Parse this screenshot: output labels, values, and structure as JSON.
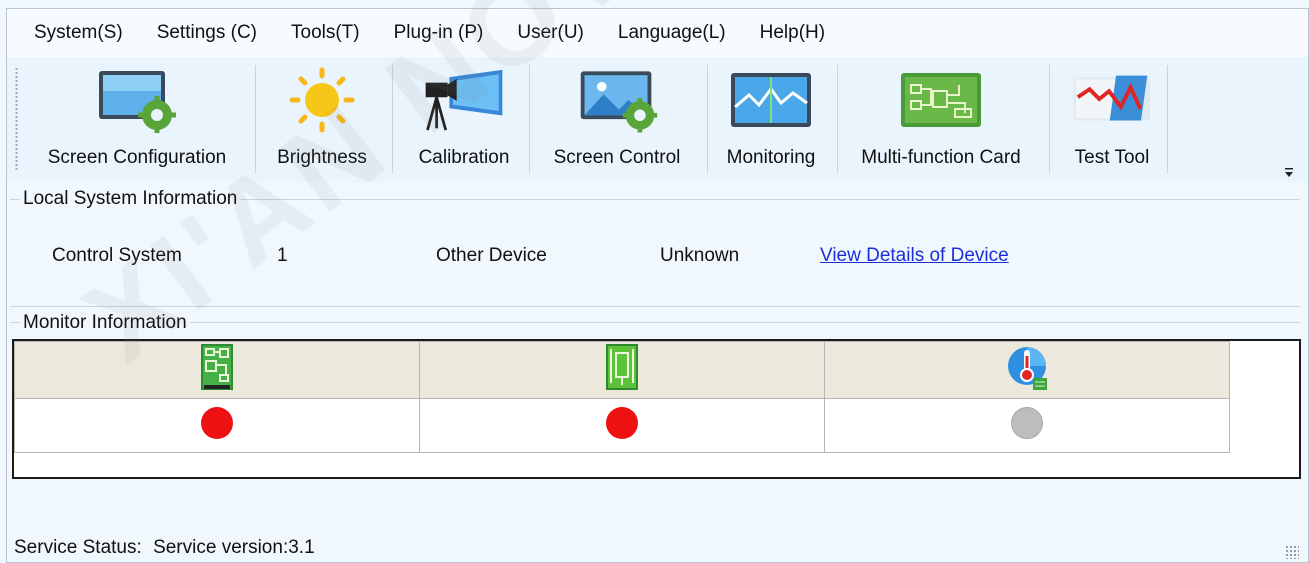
{
  "menu": {
    "items": [
      "System(S)",
      "Settings (C)",
      "Tools(T)",
      "Plug-in (P)",
      "User(U)",
      "Language(L)",
      "Help(H)"
    ]
  },
  "toolbar": {
    "tools": [
      {
        "label": "Screen Configuration",
        "icon": "screen-configuration-icon"
      },
      {
        "label": "Brightness",
        "icon": "brightness-sun-icon"
      },
      {
        "label": "Calibration",
        "icon": "calibration-camera-icon"
      },
      {
        "label": "Screen Control",
        "icon": "screen-control-icon"
      },
      {
        "label": "Monitoring",
        "icon": "monitoring-icon"
      },
      {
        "label": "Multi-function Card",
        "icon": "multi-function-card-icon"
      },
      {
        "label": "Test Tool",
        "icon": "test-tool-icon"
      }
    ]
  },
  "local_system": {
    "title": "Local System Information",
    "control_system_label": "Control System",
    "control_system_value": "1",
    "other_device_label": "Other Device",
    "other_device_value": "Unknown",
    "details_link": "View Details of Device"
  },
  "monitor": {
    "title": "Monitor Information",
    "columns": [
      {
        "icon": "sending-card-icon",
        "status": "error",
        "status_color": "#ee1111"
      },
      {
        "icon": "receiving-card-icon",
        "status": "error",
        "status_color": "#ee1111"
      },
      {
        "icon": "temperature-icon",
        "status": "unknown",
        "status_color": "#bdbdbd"
      }
    ]
  },
  "status_bar": {
    "label": "Service Status:",
    "value": "Service version:3.1"
  },
  "watermark": "XI'AN NOVASTAR"
}
